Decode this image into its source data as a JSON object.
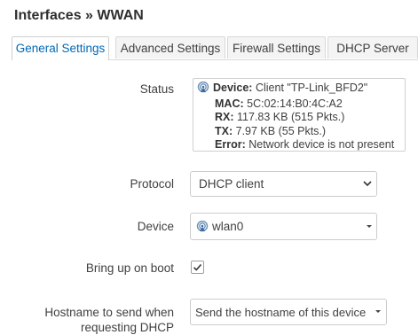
{
  "page": {
    "title": "Interfaces » WWAN"
  },
  "tabs": [
    {
      "label": "General Settings",
      "active": true
    },
    {
      "label": "Advanced Settings",
      "active": false
    },
    {
      "label": "Firewall Settings",
      "active": false
    },
    {
      "label": "DHCP Server",
      "active": false
    }
  ],
  "status": {
    "label": "Status",
    "icon": "wifi-signal-icon",
    "lines": [
      {
        "key": "Device:",
        "value": "Client \"TP-Link_BFD2\""
      },
      {
        "key": "MAC:",
        "value": "5C:02:14:B0:4C:A2"
      },
      {
        "key": "RX:",
        "value": "117.83 KB (515 Pkts.)"
      },
      {
        "key": "TX:",
        "value": "7.97 KB (55 Pkts.)"
      },
      {
        "key": "Error:",
        "value": "Network device is not present"
      }
    ]
  },
  "protocol": {
    "label": "Protocol",
    "value": "DHCP client",
    "icon": "chevron-down-icon"
  },
  "device": {
    "label": "Device",
    "value": "wlan0",
    "icon": "wifi-signal-icon"
  },
  "boot": {
    "label": "Bring up on boot",
    "checked": true
  },
  "hostname": {
    "label_line1": "Hostname to send when",
    "label_line2": "requesting DHCP",
    "value": "Send the hostname of this device"
  },
  "colors": {
    "accent": "#0069b4",
    "border": "#cccccc",
    "text": "#404040"
  }
}
